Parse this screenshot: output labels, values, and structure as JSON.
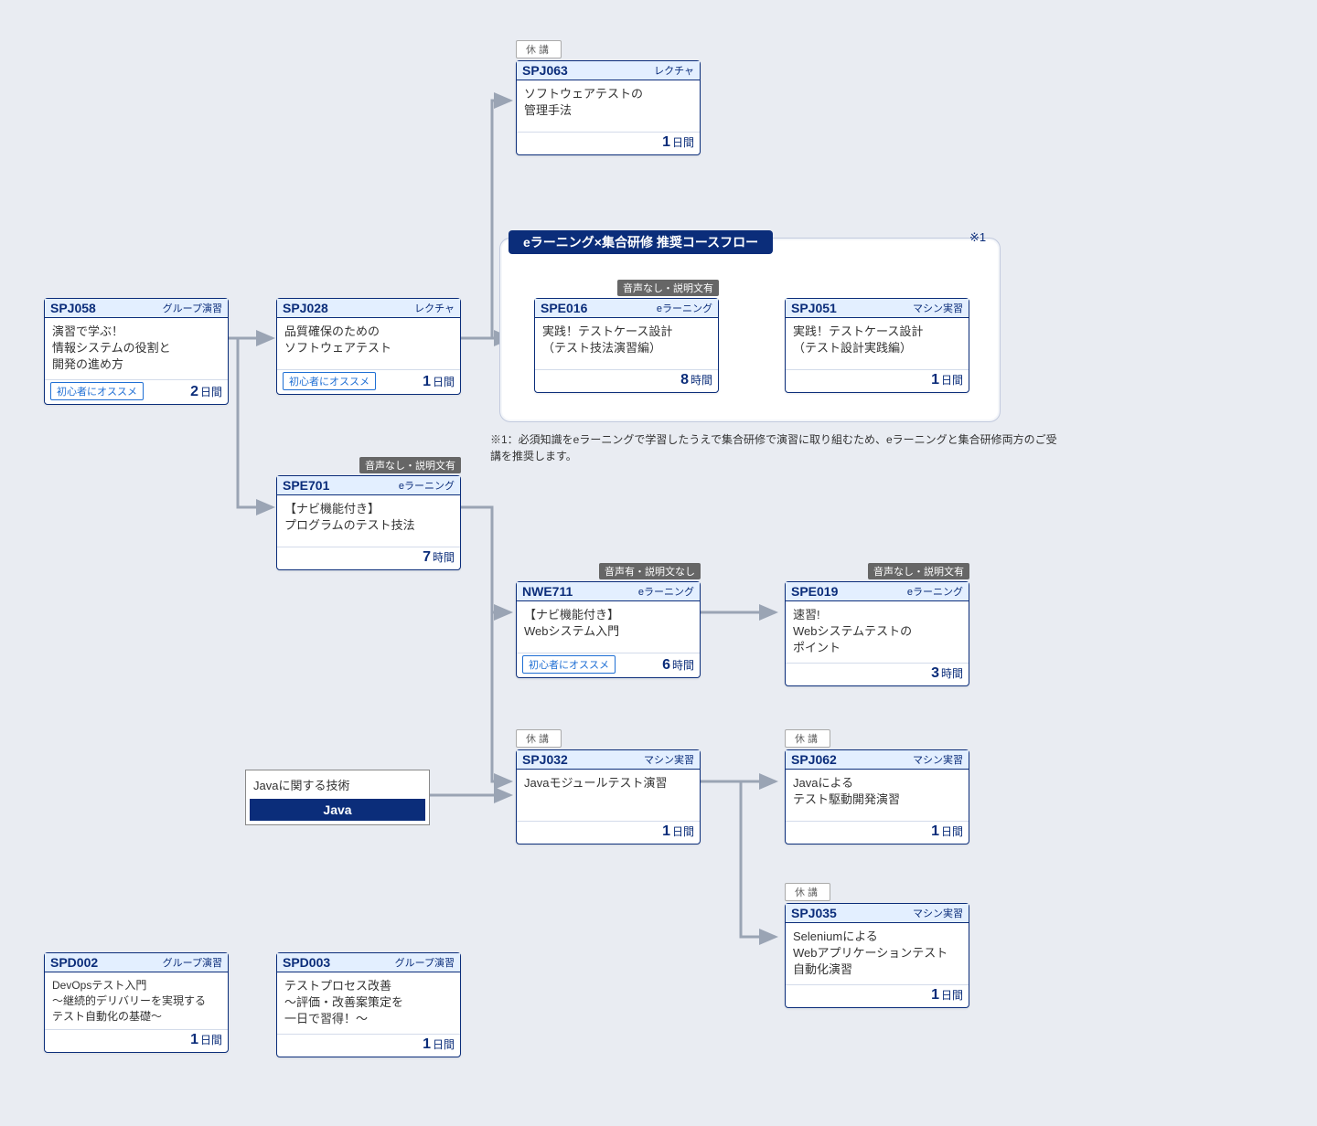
{
  "group": {
    "title": "eラーニング×集合研修 推奨コースフロー",
    "mark": "※1",
    "footnote": "※1：必須知識をeラーニングで学習したうえで集合研修で演習に取り組むため、eラーニングと集合研修両方のご受講を推奨します。"
  },
  "badges": {
    "recommend": "初心者にオススメ",
    "closed": "休講",
    "audio_none_desc_yes": "音声なし・説明文有",
    "audio_yes_desc_none": "音声有・説明文なし"
  },
  "tech": {
    "label": "Javaに関する技術",
    "name": "Java"
  },
  "nodes": {
    "spj058": {
      "code": "SPJ058",
      "type": "グループ演習",
      "title": "演習で学ぶ！\n情報システムの役割と\n開発の進め方",
      "dur_num": "2",
      "dur_unit": "日間",
      "recommend": true
    },
    "spj028": {
      "code": "SPJ028",
      "type": "レクチャ",
      "title": "品質確保のための\nソフトウェアテスト",
      "dur_num": "1",
      "dur_unit": "日間",
      "recommend": true
    },
    "spe701": {
      "code": "SPE701",
      "type": "eラーニング",
      "title": "【ナビ機能付き】\nプログラムのテスト技法",
      "dur_num": "7",
      "dur_unit": "時間",
      "audio": "audio_none_desc_yes"
    },
    "spj063": {
      "code": "SPJ063",
      "type": "レクチャ",
      "title": "ソフトウェアテストの\n管理手法",
      "dur_num": "1",
      "dur_unit": "日間",
      "closed": true
    },
    "spe016": {
      "code": "SPE016",
      "type": "eラーニング",
      "title": "実践！テストケース設計\n（テスト技法演習編）",
      "dur_num": "8",
      "dur_unit": "時間",
      "audio": "audio_none_desc_yes"
    },
    "spj051": {
      "code": "SPJ051",
      "type": "マシン実習",
      "title": "実践！テストケース設計\n（テスト設計実践編）",
      "dur_num": "1",
      "dur_unit": "日間"
    },
    "nwe711": {
      "code": "NWE711",
      "type": "eラーニング",
      "title": "【ナビ機能付き】\nWebシステム入門",
      "dur_num": "6",
      "dur_unit": "時間",
      "recommend": true,
      "audio": "audio_yes_desc_none"
    },
    "spe019": {
      "code": "SPE019",
      "type": "eラーニング",
      "title": "速習!\nWebシステムテストの\nポイント",
      "dur_num": "3",
      "dur_unit": "時間",
      "audio": "audio_none_desc_yes"
    },
    "spj032": {
      "code": "SPJ032",
      "type": "マシン実習",
      "title": "Javaモジュールテスト演習",
      "dur_num": "1",
      "dur_unit": "日間",
      "closed": true
    },
    "spj062": {
      "code": "SPJ062",
      "type": "マシン実習",
      "title": "Javaによる\nテスト駆動開発演習",
      "dur_num": "1",
      "dur_unit": "日間",
      "closed": true
    },
    "spj035": {
      "code": "SPJ035",
      "type": "マシン実習",
      "title": "Seleniumによる\nWebアプリケーションテスト\n自動化演習",
      "dur_num": "1",
      "dur_unit": "日間",
      "closed": true
    },
    "spd002": {
      "code": "SPD002",
      "type": "グループ演習",
      "title": "DevOpsテスト入門\n～継続的デリバリーを実現する\nテスト自動化の基礎～",
      "dur_num": "1",
      "dur_unit": "日間"
    },
    "spd003": {
      "code": "SPD003",
      "type": "グループ演習",
      "title": "テストプロセス改善\n～評価・改善案策定を\n一日で習得！～",
      "dur_num": "1",
      "dur_unit": "日間"
    }
  }
}
